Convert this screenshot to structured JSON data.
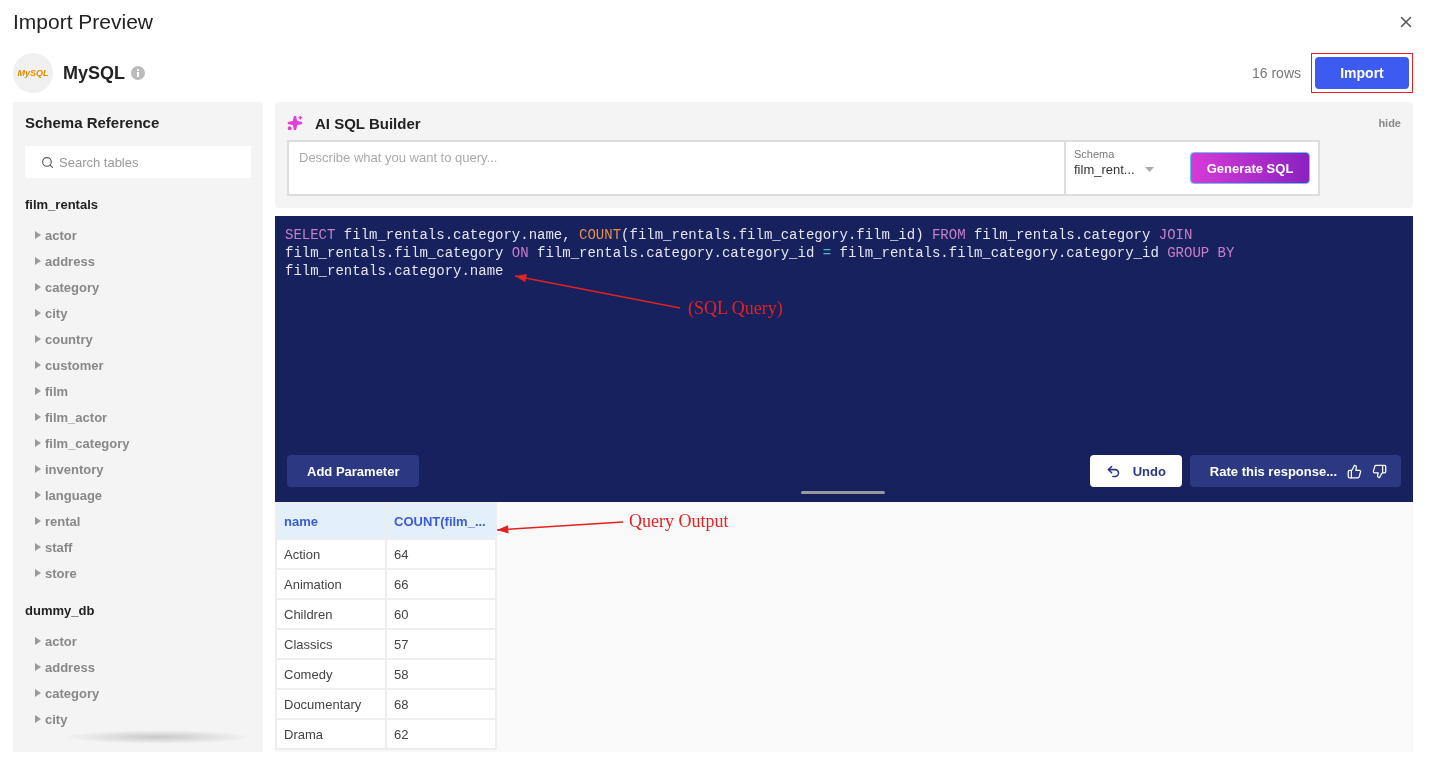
{
  "dialog": {
    "title": "Import Preview"
  },
  "source": {
    "name": "MySQL",
    "logo_text": "MySQL"
  },
  "row_count": "16 rows",
  "import_button": {
    "label": "Import",
    "highlighted": true
  },
  "schema_panel": {
    "title": "Schema Reference",
    "search": {
      "placeholder": "Search tables"
    },
    "databases": [
      {
        "name": "film_rentals",
        "children": [
          {
            "name": "actor",
            "expanded": false
          },
          {
            "name": "address",
            "expanded": false
          },
          {
            "name": "category",
            "expanded": false
          },
          {
            "name": "city",
            "expanded": false
          },
          {
            "name": "country",
            "expanded": false
          },
          {
            "name": "customer",
            "expanded": false
          },
          {
            "name": "film",
            "expanded": false
          },
          {
            "name": "film_actor",
            "expanded": false
          },
          {
            "name": "film_category",
            "expanded": false
          },
          {
            "name": "inventory",
            "expanded": false
          },
          {
            "name": "language",
            "expanded": false
          },
          {
            "name": "rental",
            "expanded": false
          },
          {
            "name": "staff",
            "expanded": false
          },
          {
            "name": "store",
            "expanded": false
          }
        ]
      },
      {
        "name": "dummy_db",
        "children": [
          {
            "name": "actor",
            "expanded": false
          },
          {
            "name": "address",
            "expanded": false
          },
          {
            "name": "category",
            "expanded": false
          },
          {
            "name": "city",
            "expanded": false
          }
        ]
      }
    ]
  },
  "ai_builder": {
    "title": "AI SQL Builder",
    "hide_label": "hide",
    "prompt": {
      "placeholder": "Describe what you want to query..."
    },
    "schema_select": {
      "label": "Schema",
      "value": "film_rent..."
    },
    "generate_button": "Generate SQL"
  },
  "editor": {
    "lines": [
      [
        {
          "text": "SELECT",
          "kind": "keyword"
        },
        {
          "text": " film_rentals.category.name, ",
          "kind": "plain"
        },
        {
          "text": "COUNT",
          "kind": "function"
        },
        {
          "text": "(film_rentals.film_category.film_id) ",
          "kind": "plain"
        },
        {
          "text": "FROM",
          "kind": "keyword"
        },
        {
          "text": " film_rentals.category ",
          "kind": "plain"
        },
        {
          "text": "JOIN",
          "kind": "keyword"
        }
      ],
      [
        {
          "text": "film_rentals.film_category ",
          "kind": "plain"
        },
        {
          "text": "ON",
          "kind": "keyword"
        },
        {
          "text": " film_rentals.category.category_id ",
          "kind": "plain"
        },
        {
          "text": "=",
          "kind": "operator"
        },
        {
          "text": " film_rentals.film_category.category_id ",
          "kind": "plain"
        },
        {
          "text": "GROUP BY",
          "kind": "keyword"
        }
      ],
      [
        {
          "text": "film_rentals.category.name",
          "kind": "plain"
        }
      ]
    ],
    "add_parameter": "Add Parameter",
    "undo": "Undo",
    "rate": "Rate this response..."
  },
  "output": {
    "columns": [
      "name",
      "COUNT(film_..."
    ],
    "rows": [
      [
        "Action",
        "64"
      ],
      [
        "Animation",
        "66"
      ],
      [
        "Children",
        "60"
      ],
      [
        "Classics",
        "57"
      ],
      [
        "Comedy",
        "58"
      ],
      [
        "Documentary",
        "68"
      ],
      [
        "Drama",
        "62"
      ]
    ]
  },
  "annotations": [
    {
      "text": "(SQL Query)"
    },
    {
      "text": "Query Output"
    }
  ]
}
